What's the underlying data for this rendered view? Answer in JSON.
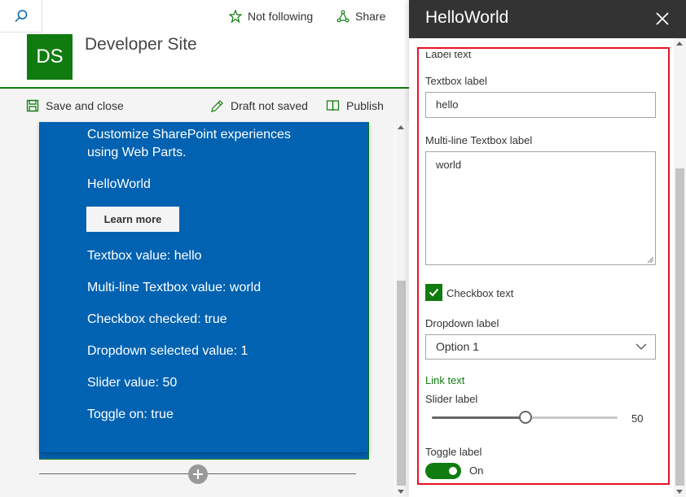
{
  "site": {
    "follow_label": "Not following",
    "share_label": "Share",
    "logo_initials": "DS",
    "title": "Developer Site"
  },
  "command_bar": {
    "save_label": "Save and close",
    "draft_label": "Draft not saved",
    "publish_label": "Publish"
  },
  "webpart": {
    "description": "Customize SharePoint experiences using Web Parts.",
    "name": "HelloWorld",
    "learn_more": "Learn more",
    "lines": [
      "Textbox value: hello",
      "Multi-line Textbox value: world",
      "Checkbox checked: true",
      "Dropdown selected value: 1",
      "Slider value: 50",
      "Toggle on: true"
    ]
  },
  "pane": {
    "title": "HelloWorld",
    "label_text": "Label text",
    "textbox_label": "Textbox label",
    "textbox_value": "hello",
    "multiline_label": "Multi-line Textbox label",
    "multiline_value": "world",
    "checkbox_label": "Checkbox text",
    "checkbox_checked": true,
    "dropdown_label": "Dropdown label",
    "dropdown_value": "Option 1",
    "link_text": "Link text",
    "slider_label": "Slider label",
    "slider_value": "50",
    "toggle_label": "Toggle label",
    "toggle_state": "On"
  },
  "colors": {
    "brand_green": "#107c10",
    "webpart_blue": "#0062b1",
    "pane_header": "#333333",
    "highlight_red": "#e81123"
  }
}
